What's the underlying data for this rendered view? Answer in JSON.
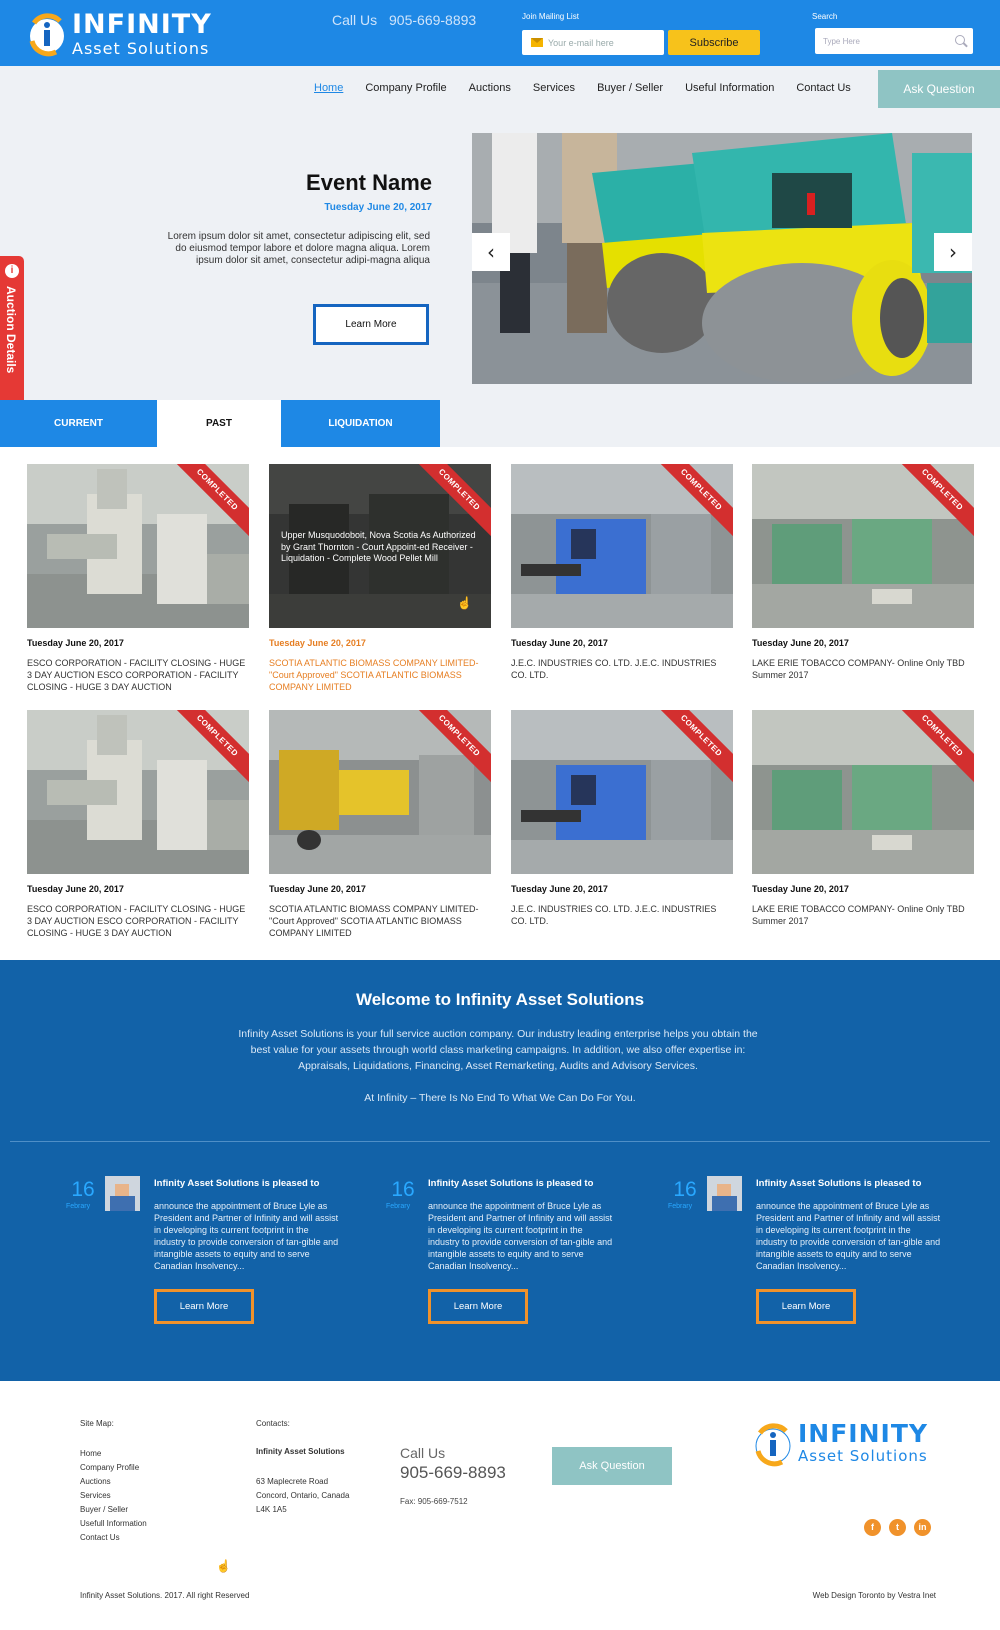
{
  "header": {
    "logo_title": "INFINITY",
    "logo_sub": "Asset Solutions",
    "call_label": "Call Us",
    "call_phone": "905-669-8893",
    "mailing_label": "Join Mailing List",
    "mail_placeholder": "Your e-mail here",
    "subscribe_label": "Subscribe",
    "search_label": "Search",
    "search_placeholder": "Type Here"
  },
  "nav": {
    "items": [
      "Home",
      "Company Profile",
      "Auctions",
      "Services",
      "Buyer / Seller",
      "Useful Information",
      "Contact Us"
    ],
    "active": "Home",
    "ask_label": "Ask Question"
  },
  "hero": {
    "title": "Event Name",
    "date": "Tuesday June 20, 2017",
    "description": "Lorem ipsum dolor sit amet, consectetur adipiscing elit, sed do eiusmod tempor labore et dolore magna aliqua. Lorem ipsum dolor sit amet, consectetur adipi-magna aliqua",
    "learn_label": "Learn More",
    "prev_icon": "chevron-left-icon",
    "next_icon": "chevron-right-icon",
    "side_tab": "Auction Details"
  },
  "tabs": [
    "CURRENT",
    "PAST",
    "LIQUIDATION"
  ],
  "auctions": [
    {
      "date": "Tuesday June 20, 2017",
      "title": "ESCO CORPORATION - FACILITY CLOSING - HUGE 3 DAY AUCTION ESCO CORPORATION - FACILITY CLOSING - HUGE 3 DAY AUCTION",
      "badge": "COMPLETED"
    },
    {
      "date": "Tuesday June 20, 2017",
      "title": "SCOTIA ATLANTIC BIOMASS COMPANY LIMITED- \"Court Approved\" SCOTIA ATLANTIC BIOMASS COMPANY LIMITED",
      "badge": "COMPLETED",
      "overlay": "Upper Musquodoboit, Nova Scotia As Authorized by Grant Thornton - Court Appoint-ed Receiver -Liquidation - Complete Wood Pellet Mill"
    },
    {
      "date": "Tuesday June 20, 2017",
      "title": "J.E.C. INDUSTRIES CO. LTD. J.E.C. INDUSTRIES CO. LTD.",
      "badge": "COMPLETED"
    },
    {
      "date": "Tuesday June 20, 2017",
      "title": "LAKE ERIE TOBACCO COMPANY- Online Only TBD Summer 2017",
      "badge": "COMPLETED"
    },
    {
      "date": "Tuesday June 20, 2017",
      "title": "ESCO CORPORATION - FACILITY CLOSING - HUGE 3 DAY AUCTION ESCO CORPORATION - FACILITY CLOSING - HUGE 3 DAY AUCTION",
      "badge": "COMPLETED"
    },
    {
      "date": "Tuesday June 20, 2017",
      "title": "SCOTIA ATLANTIC BIOMASS COMPANY LIMITED- \"Court Approved\" SCOTIA ATLANTIC BIOMASS COMPANY LIMITED",
      "badge": "COMPLETED"
    },
    {
      "date": "Tuesday June 20, 2017",
      "title": "J.E.C. INDUSTRIES CO. LTD. J.E.C. INDUSTRIES CO. LTD.",
      "badge": "COMPLETED"
    },
    {
      "date": "Tuesday June 20, 2017",
      "title": "LAKE ERIE TOBACCO COMPANY- Online Only TBD Summer 2017",
      "badge": "COMPLETED"
    }
  ],
  "welcome": {
    "title": "Welcome to Infinity Asset Solutions",
    "intro": "Infinity Asset Solutions is your full service auction company. Our industry leading enterprise helps you obtain the best value for your assets through world class marketing campaigns. In addition, we also offer expertise in:  Appraisals, Liquidations, Financing, Asset Remarketing, Audits and Advisory Services.",
    "tagline": "At Infinity – There Is No End To What We Can Do For You."
  },
  "news": [
    {
      "day": "16",
      "month": "Febrary",
      "headline": "Infinity Asset Solutions is pleased to",
      "body": "announce the appointment of Bruce Lyle as President and Partner of Infinity and will assist in developing its current footprint in the industry to provide conversion of tan-gible and intangible assets to equity and to serve Canadian Insolvency...",
      "button": "Learn More"
    },
    {
      "day": "16",
      "month": "Febrary",
      "headline": "Infinity Asset Solutions is pleased to",
      "body": "announce the appointment of Bruce Lyle as President and Partner of Infinity and will assist in developing its current footprint in the industry to provide conversion of tan-gible and intangible assets to equity and to serve Canadian Insolvency...",
      "button": "Learn More"
    },
    {
      "day": "16",
      "month": "Febrary",
      "headline": "Infinity Asset Solutions is pleased to",
      "body": "announce the appointment of Bruce Lyle as President and Partner of Infinity and will assist in developing its current footprint in the industry to provide conversion of tan-gible and intangible assets to equity and to serve Canadian Insolvency...",
      "button": "Learn More"
    }
  ],
  "footer": {
    "sitemap_label": "Site Map:",
    "sitemap": [
      "Home",
      "Company Profile",
      "Auctions",
      "Services",
      "Buyer / Seller",
      "Usefull Information",
      "Contact Us"
    ],
    "contacts_label": "Contacts:",
    "company": "Infinity Asset Solutions",
    "addr1": "63 Maplecrete Road",
    "addr2": "Concord, Ontario, Canada",
    "addr3": "L4K 1A5",
    "call_label": "Call Us",
    "call_phone": "905-669-8893",
    "fax": "Fax: 905-669-7512",
    "ask_label": "Ask Question",
    "logo_title": "INFINITY",
    "logo_sub": "Asset Solutions",
    "social": [
      "facebook-icon",
      "twitter-icon",
      "linkedin-icon"
    ],
    "copyright": "Infinity Asset Solutions. 2017. All right Reserved",
    "credit": "Web Design Toronto by Vestra Inet"
  },
  "colors": {
    "brand_blue": "#1e88e5",
    "dark_blue": "#1262a8",
    "accent_yellow": "#f7c21b",
    "accent_orange": "#f0922b",
    "badge_red": "#d32f2f",
    "teal_button": "#8fc4c4"
  }
}
